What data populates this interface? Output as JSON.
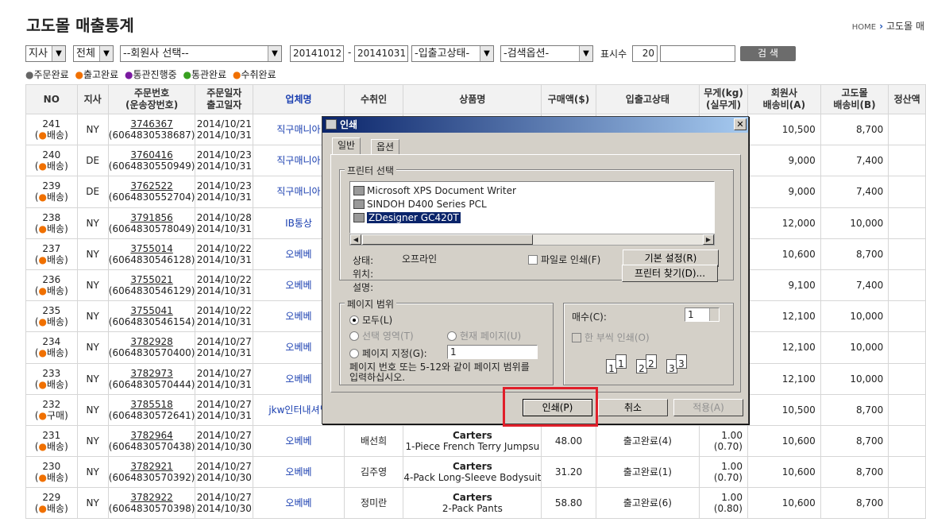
{
  "page": {
    "title": "고도몰 매출통계",
    "breadcrumb_home": "HOME",
    "breadcrumb_sep": "›",
    "breadcrumb_current": "고도몰 매"
  },
  "filters": {
    "branch": "지사",
    "all": "전체",
    "member": "--회원사 선택--",
    "date_from": "20141012",
    "date_dash": "-",
    "date_to": "20141031",
    "status": "-입출고상태-",
    "search_option": "-검색옵션-",
    "display_count_label": "표시수",
    "display_count": "20",
    "keyword": "",
    "search_button": "검 색"
  },
  "legend": [
    {
      "label": "주문완료",
      "color": "#666666"
    },
    {
      "label": "출고완료",
      "color": "#f07000"
    },
    {
      "label": "통관진행중",
      "color": "#7a1aa0"
    },
    {
      "label": "통관완료",
      "color": "#38a020"
    },
    {
      "label": "수취완료",
      "color": "#f07000"
    }
  ],
  "table": {
    "headers": {
      "no": "NO",
      "branch": "지사",
      "order_no_1": "주문번호",
      "order_no_2": "(운송장번호)",
      "order_date_1": "주문일자",
      "order_date_2": "출고일자",
      "company": "업체명",
      "receiver": "수취인",
      "product": "상품명",
      "amount": "구매액($)",
      "status": "입출고상태",
      "weight_1": "무게(kg)",
      "weight_2": "(실무게)",
      "member_fee_1": "회원사",
      "member_fee_2": "배송비(A)",
      "godo_fee_1": "고도몰",
      "godo_fee_2": "배송비(B)",
      "settle": "정산액"
    },
    "rows": [
      {
        "no": "241",
        "type": "배송",
        "branch": "NY",
        "order": "3746367",
        "waybill": "(6064830538687)",
        "order_date": "2014/10/21",
        "ship_date": "2014/10/31",
        "company": "직구매니아",
        "receiver": "",
        "brand": "",
        "product": "",
        "amount": "",
        "status": "",
        "weight": "",
        "real_weight": "",
        "member_fee": "10,500",
        "godo_fee": "8,700"
      },
      {
        "no": "240",
        "type": "배송",
        "branch": "DE",
        "order": "3760416",
        "waybill": "(6064830550949)",
        "order_date": "2014/10/23",
        "ship_date": "2014/10/31",
        "company": "직구매니아",
        "receiver": "",
        "brand": "",
        "product": "",
        "amount": "",
        "status": "",
        "weight": "",
        "real_weight": "",
        "member_fee": "9,000",
        "godo_fee": "7,400"
      },
      {
        "no": "239",
        "type": "배송",
        "branch": "DE",
        "order": "3762522",
        "waybill": "(6064830552704)",
        "order_date": "2014/10/23",
        "ship_date": "2014/10/31",
        "company": "직구매니아",
        "receiver": "",
        "brand": "",
        "product": "",
        "amount": "",
        "status": "",
        "weight": "",
        "real_weight": "",
        "member_fee": "9,000",
        "godo_fee": "7,400"
      },
      {
        "no": "238",
        "type": "배송",
        "branch": "NY",
        "order": "3791856",
        "waybill": "(6064830578049)",
        "order_date": "2014/10/28",
        "ship_date": "2014/10/31",
        "company": "IB통상",
        "receiver": "",
        "brand": "",
        "product": "",
        "amount": "",
        "status": "",
        "weight": "",
        "real_weight": "",
        "member_fee": "12,000",
        "godo_fee": "10,000"
      },
      {
        "no": "237",
        "type": "배송",
        "branch": "NY",
        "order": "3755014",
        "waybill": "(6064830546128)",
        "order_date": "2014/10/22",
        "ship_date": "2014/10/31",
        "company": "오베베",
        "receiver": "",
        "brand": "",
        "product": "",
        "amount": "",
        "status": "",
        "weight": "",
        "real_weight": "",
        "member_fee": "10,600",
        "godo_fee": "8,700"
      },
      {
        "no": "236",
        "type": "배송",
        "branch": "NY",
        "order": "3755021",
        "waybill": "(6064830546129)",
        "order_date": "2014/10/22",
        "ship_date": "2014/10/31",
        "company": "오베베",
        "receiver": "",
        "brand": "",
        "product": "",
        "amount": "",
        "status": "",
        "weight": "",
        "real_weight": "",
        "member_fee": "9,100",
        "godo_fee": "7,400"
      },
      {
        "no": "235",
        "type": "배송",
        "branch": "NY",
        "order": "3755041",
        "waybill": "(6064830546154)",
        "order_date": "2014/10/22",
        "ship_date": "2014/10/31",
        "company": "오베베",
        "receiver": "",
        "brand": "",
        "product": "",
        "amount": "",
        "status": "",
        "weight": "",
        "real_weight": "",
        "member_fee": "12,100",
        "godo_fee": "10,000"
      },
      {
        "no": "234",
        "type": "배송",
        "branch": "NY",
        "order": "3782928",
        "waybill": "(6064830570400)",
        "order_date": "2014/10/27",
        "ship_date": "2014/10/31",
        "company": "오베베",
        "receiver": "",
        "brand": "",
        "product": "",
        "amount": "",
        "status": "",
        "weight": "",
        "real_weight": "",
        "member_fee": "12,100",
        "godo_fee": "10,000"
      },
      {
        "no": "233",
        "type": "배송",
        "branch": "NY",
        "order": "3782973",
        "waybill": "(6064830570444)",
        "order_date": "2014/10/27",
        "ship_date": "2014/10/31",
        "company": "오베베",
        "receiver": "",
        "brand": "",
        "product": "",
        "amount": "",
        "status": "",
        "weight": "",
        "real_weight": "",
        "member_fee": "12,100",
        "godo_fee": "10,000"
      },
      {
        "no": "232",
        "type": "구매",
        "branch": "NY",
        "order": "3785518",
        "waybill": "(6064830572641)",
        "order_date": "2014/10/27",
        "ship_date": "2014/10/31",
        "company": "jkw인터내셔널",
        "receiver": "",
        "brand": "",
        "product": "",
        "amount": "",
        "status": "",
        "weight": "",
        "real_weight": "",
        "member_fee": "10,500",
        "godo_fee": "8,700"
      },
      {
        "no": "231",
        "type": "배송",
        "branch": "NY",
        "order": "3782964",
        "waybill": "(6064830570438)",
        "order_date": "2014/10/27",
        "ship_date": "2014/10/30",
        "company": "오베베",
        "receiver": "배선희",
        "brand": "Carters",
        "product": "1-Piece French Terry Jumpsu",
        "amount": "48.00",
        "status": "출고완료(4)",
        "weight": "1.00",
        "real_weight": "(0.70)",
        "member_fee": "10,600",
        "godo_fee": "8,700"
      },
      {
        "no": "230",
        "type": "배송",
        "branch": "NY",
        "order": "3782921",
        "waybill": "(6064830570392)",
        "order_date": "2014/10/27",
        "ship_date": "2014/10/30",
        "company": "오베베",
        "receiver": "김주영",
        "brand": "Carters",
        "product": "4-Pack Long-Sleeve Bodysuit",
        "amount": "31.20",
        "status": "출고완료(1)",
        "weight": "1.00",
        "real_weight": "(0.70)",
        "member_fee": "10,600",
        "godo_fee": "8,700"
      },
      {
        "no": "229",
        "type": "배송",
        "branch": "NY",
        "order": "3782922",
        "waybill": "(6064830570398)",
        "order_date": "2014/10/27",
        "ship_date": "2014/10/30",
        "company": "오베베",
        "receiver": "정미란",
        "brand": "Carters",
        "product": "2-Pack Pants",
        "amount": "58.80",
        "status": "출고완료(6)",
        "weight": "1.00",
        "real_weight": "(0.80)",
        "member_fee": "10,600",
        "godo_fee": "8,700"
      }
    ]
  },
  "dialog": {
    "title": "인쇄",
    "close": "✕",
    "tab_general": "일반",
    "tab_options": "옵션",
    "printer_group": "프린터 선택",
    "printers": [
      "Microsoft XPS Document Writer",
      "SINDOH D400 Series PCL",
      "ZDesigner GC420T"
    ],
    "status_label": "상태:",
    "status_value": "오프라인",
    "location_label": "위치:",
    "comment_label": "설명:",
    "print_to_file": "파일로 인쇄(F)",
    "preferences_button": "기본 설정(R)",
    "find_printer_button": "프린터 찾기(D)...",
    "page_range_group": "페이지 범위",
    "range_all": "모두(L)",
    "range_selection": "선택 영역(T)",
    "range_current": "현재 페이지(U)",
    "range_pages": "페이지 지정(G):",
    "pages_value": "1",
    "range_hint_1": "페이지 번호 또는 5-12와 같이 페이지 범위를",
    "range_hint_2": "입력하십시오.",
    "copies_label": "매수(C):",
    "copies_value": "1",
    "collate_label": "한 부씩 인쇄(O)",
    "collate_pages": [
      "1",
      "1",
      "2",
      "2",
      "3",
      "3"
    ],
    "print_button": "인쇄(P)",
    "cancel_button": "취소",
    "apply_button": "적용(A)"
  }
}
